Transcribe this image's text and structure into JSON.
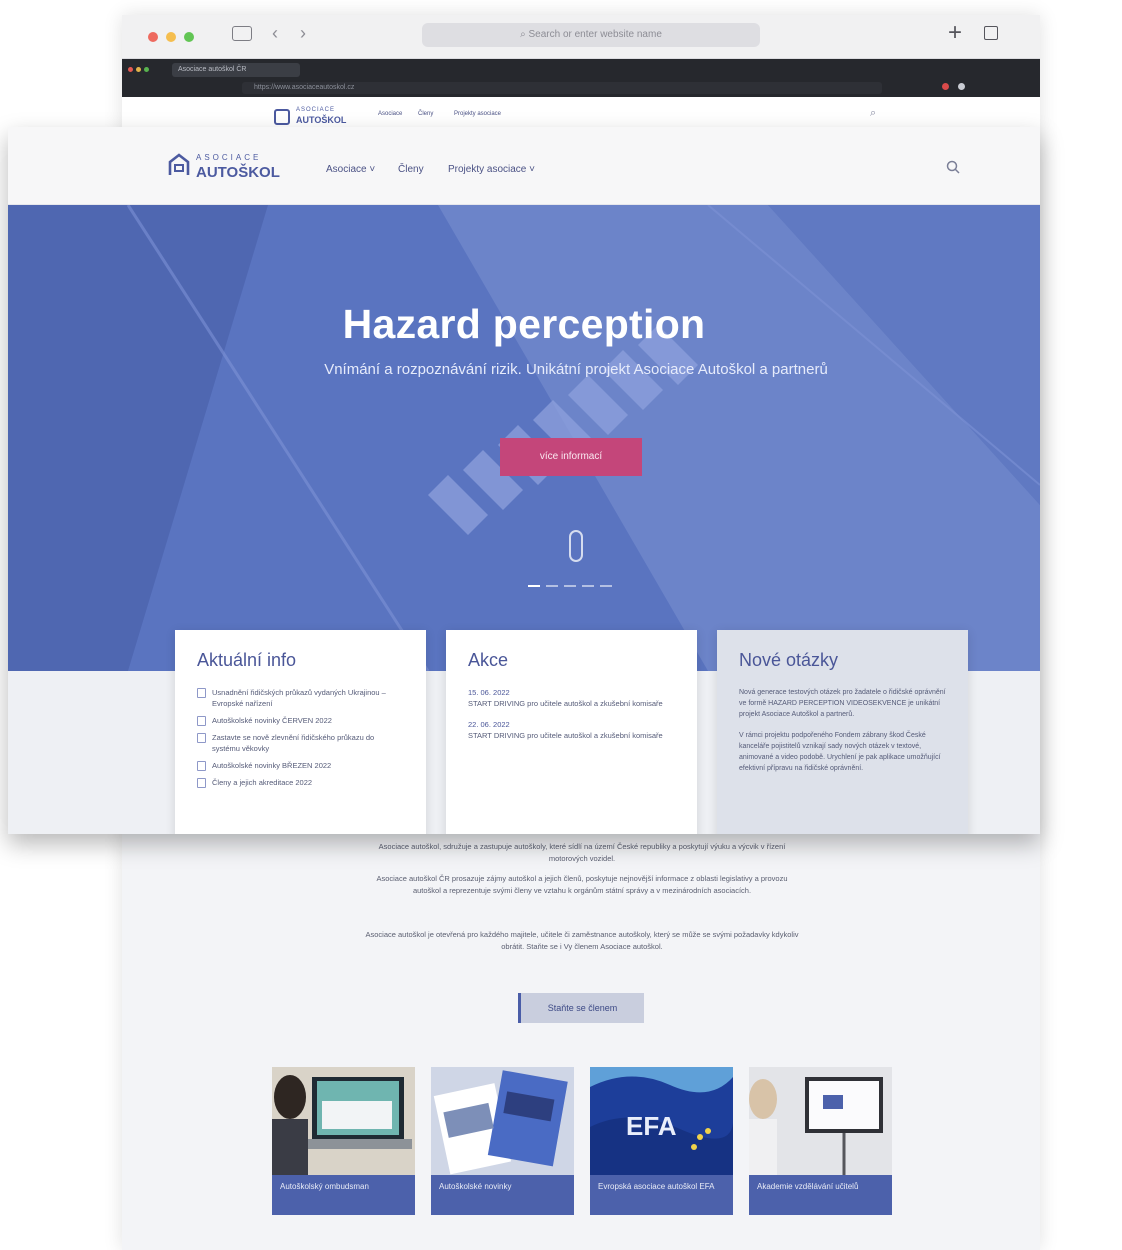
{
  "browser_back": {
    "url_placeholder": "Search or enter website name",
    "add_tab_label": "+",
    "dark_tab_label": "Asociace autoškol ČR",
    "dark_url": "https://www.asociaceautoskol.cz"
  },
  "back_nav": {
    "logo_top": "ASOCIACE",
    "logo_bottom": "AUTOŠKOL",
    "items": [
      "Asociace",
      "Členy",
      "Projekty asociace"
    ]
  },
  "front_nav": {
    "logo_top": "ASOCIACE",
    "logo_bottom": "AUTOŠKOL",
    "items": [
      "Asociace",
      "Členy",
      "Projekty asociace"
    ]
  },
  "hero": {
    "title": "Hazard perception",
    "subtitle": "Vnímání a rozpoznávání rizik. Unikátní projekt Asociace Autoškol a partnerů",
    "cta": "více informací",
    "slide_count": 5,
    "active_slide": 1,
    "colors": {
      "overlay": "#5a74c0",
      "cta": "#c4467a"
    }
  },
  "cards": {
    "info": {
      "title": "Aktuální info",
      "items": [
        "Usnadnění řidičských průkazů vydaných Ukrajinou – Evropské nařízení",
        "Autoškolské novinky ČERVEN 2022",
        "Zastavte se nově zlevnění řidičského průkazu do systému věkovky",
        "Autoškolské novinky BŘEZEN 2022",
        "Členy a jejich akreditace 2022"
      ]
    },
    "events": {
      "title": "Akce",
      "items": [
        {
          "date": "15. 06. 2022",
          "text": "START DRIVING pro učitele autoškol a zkušební komisaře"
        },
        {
          "date": "22. 06. 2022",
          "text": "START DRIVING pro učitele autoškol a zkušební komisaře"
        }
      ]
    },
    "new_questions": {
      "title": "Nové otázky",
      "paragraphs": [
        "Nová generace testových otázek pro žadatele o řidičské oprávnění ve formě HAZARD PERCEPTION VIDEOSEKVENCE je unikátní projekt Asociace Autoškol a partnerů.",
        "V rámci projektu podpořeného Fondem zábrany škod České kanceláře pojistitelů vznikají sady nových otázek v textové, animované a video podobě. Urychlení je pak aplikace umožňující efektivní přípravu na řidičské oprávnění."
      ]
    }
  },
  "lower": {
    "paragraphs": [
      "Asociace autoškol, sdružuje a zastupuje autoškoly, které sídlí na území České republiky a poskytují výuku a výcvik v řízení motorových vozidel.",
      "Asociace autoškol ČR prosazuje zájmy autoškol a jejich členů, poskytuje nejnovější informace z oblasti legislativy a provozu autoškol a reprezentuje svými členy ve vztahu k orgánům státní správy a v mezinárodních asociacích.",
      "Asociace autoškol je otevřená pro každého majitele, učitele či zaměstnance autoškoly, který se může se svými požadavky kdykoliv obrátit. Staňte se i Vy členem Asociace autoškol."
    ],
    "button": "Staňte se členem",
    "tiles": [
      "Autoškolský ombudsman",
      "Autoškolské novinky",
      "Evropská asociace autoškol EFA",
      "Akademie vzdělávání učitelů"
    ],
    "flag_text": "EFA"
  }
}
